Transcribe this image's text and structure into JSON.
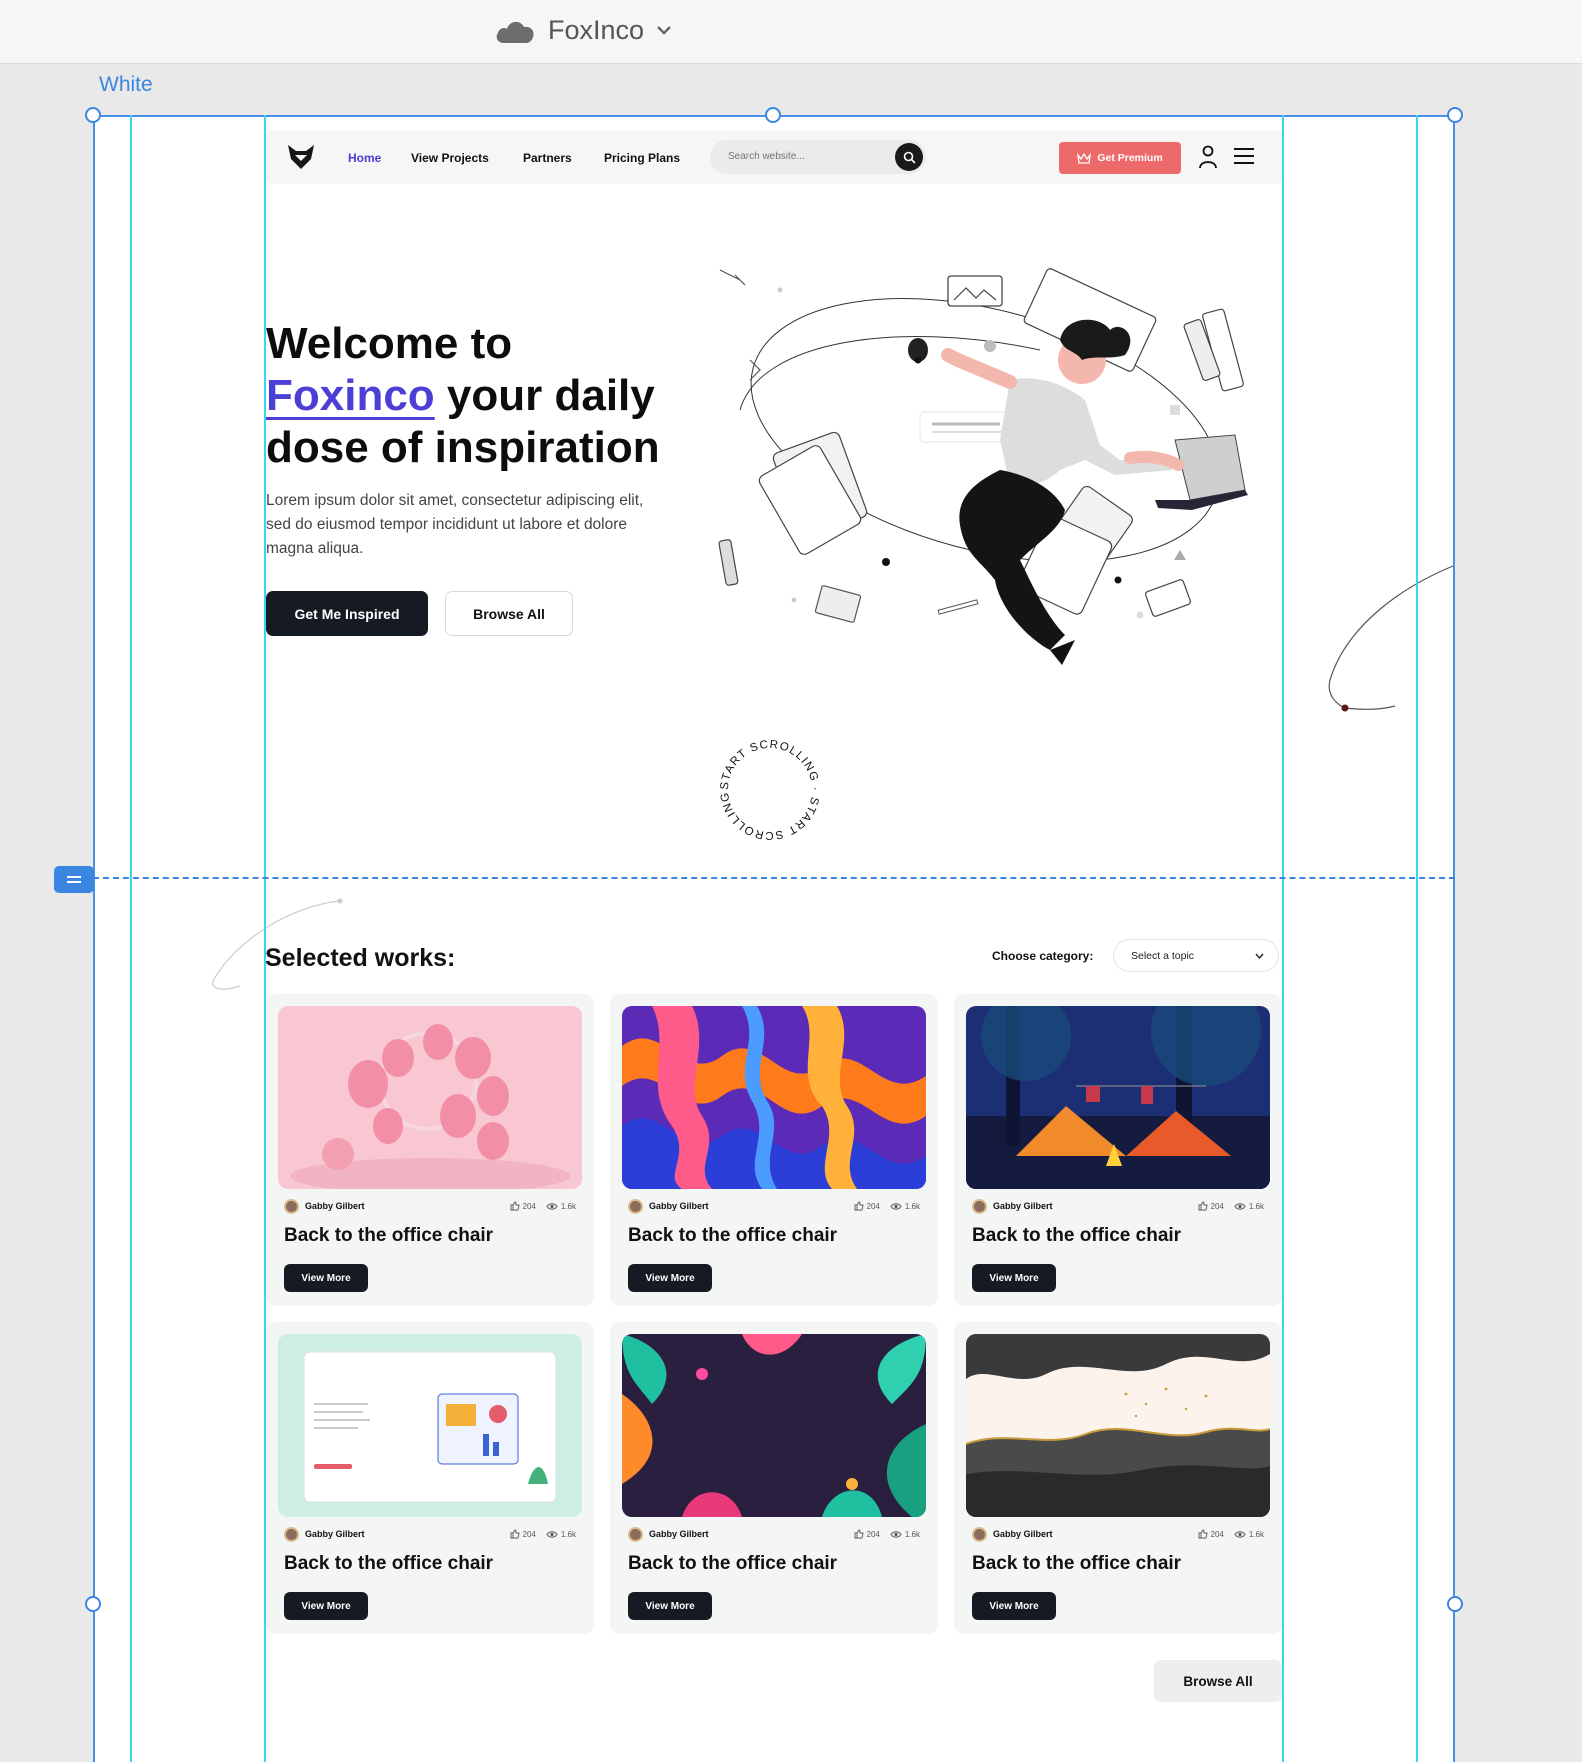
{
  "app": {
    "title": "FoxInco",
    "artboard_label": "White"
  },
  "nav": {
    "items": [
      {
        "label": "Home",
        "active": true
      },
      {
        "label": "View Projects"
      },
      {
        "label": "Partners"
      },
      {
        "label": "Pricing Plans"
      }
    ],
    "search_placeholder": "Search website...",
    "premium_label": "Get Premium",
    "accent_color": "#4b3fd6",
    "premium_color": "#ee6a6a"
  },
  "hero": {
    "title_line1": "Welcome to",
    "title_accent": "Foxinco",
    "title_rest": " your daily dose of inspiration",
    "text": "Lorem ipsum dolor sit amet, consectetur adipiscing elit, sed do eiusmod tempor incididunt ut labore et dolore magna aliqua.",
    "cta_primary": "Get Me Inspired",
    "cta_secondary": "Browse All",
    "scroll_badge": "START SCROLLING · START SCROLLING ·"
  },
  "works": {
    "title": "Selected works:",
    "category_label": "Choose category:",
    "category_value": "Select a topic",
    "cards": [
      {
        "author": "Gabby Gilbert",
        "likes": "204",
        "views": "1.6k",
        "title": "Back to the office chair",
        "button": "View More",
        "image": "pink-balloons"
      },
      {
        "author": "Gabby Gilbert",
        "likes": "204",
        "views": "1.6k",
        "title": "Back to the office chair",
        "button": "View More",
        "image": "abstract-waves"
      },
      {
        "author": "Gabby Gilbert",
        "likes": "204",
        "views": "1.6k",
        "title": "Back to the office chair",
        "button": "View More",
        "image": "camping-night"
      },
      {
        "author": "Gabby Gilbert",
        "likes": "204",
        "views": "1.6k",
        "title": "Back to the office chair",
        "button": "View More",
        "image": "content-management"
      },
      {
        "author": "Gabby Gilbert",
        "likes": "204",
        "views": "1.6k",
        "title": "Back to the office chair",
        "button": "View More",
        "image": "tropical-leaves"
      },
      {
        "author": "Gabby Gilbert",
        "likes": "204",
        "views": "1.6k",
        "title": "Back to the office chair",
        "button": "View More",
        "image": "ink-watercolor"
      }
    ],
    "browse_all": "Browse All"
  }
}
